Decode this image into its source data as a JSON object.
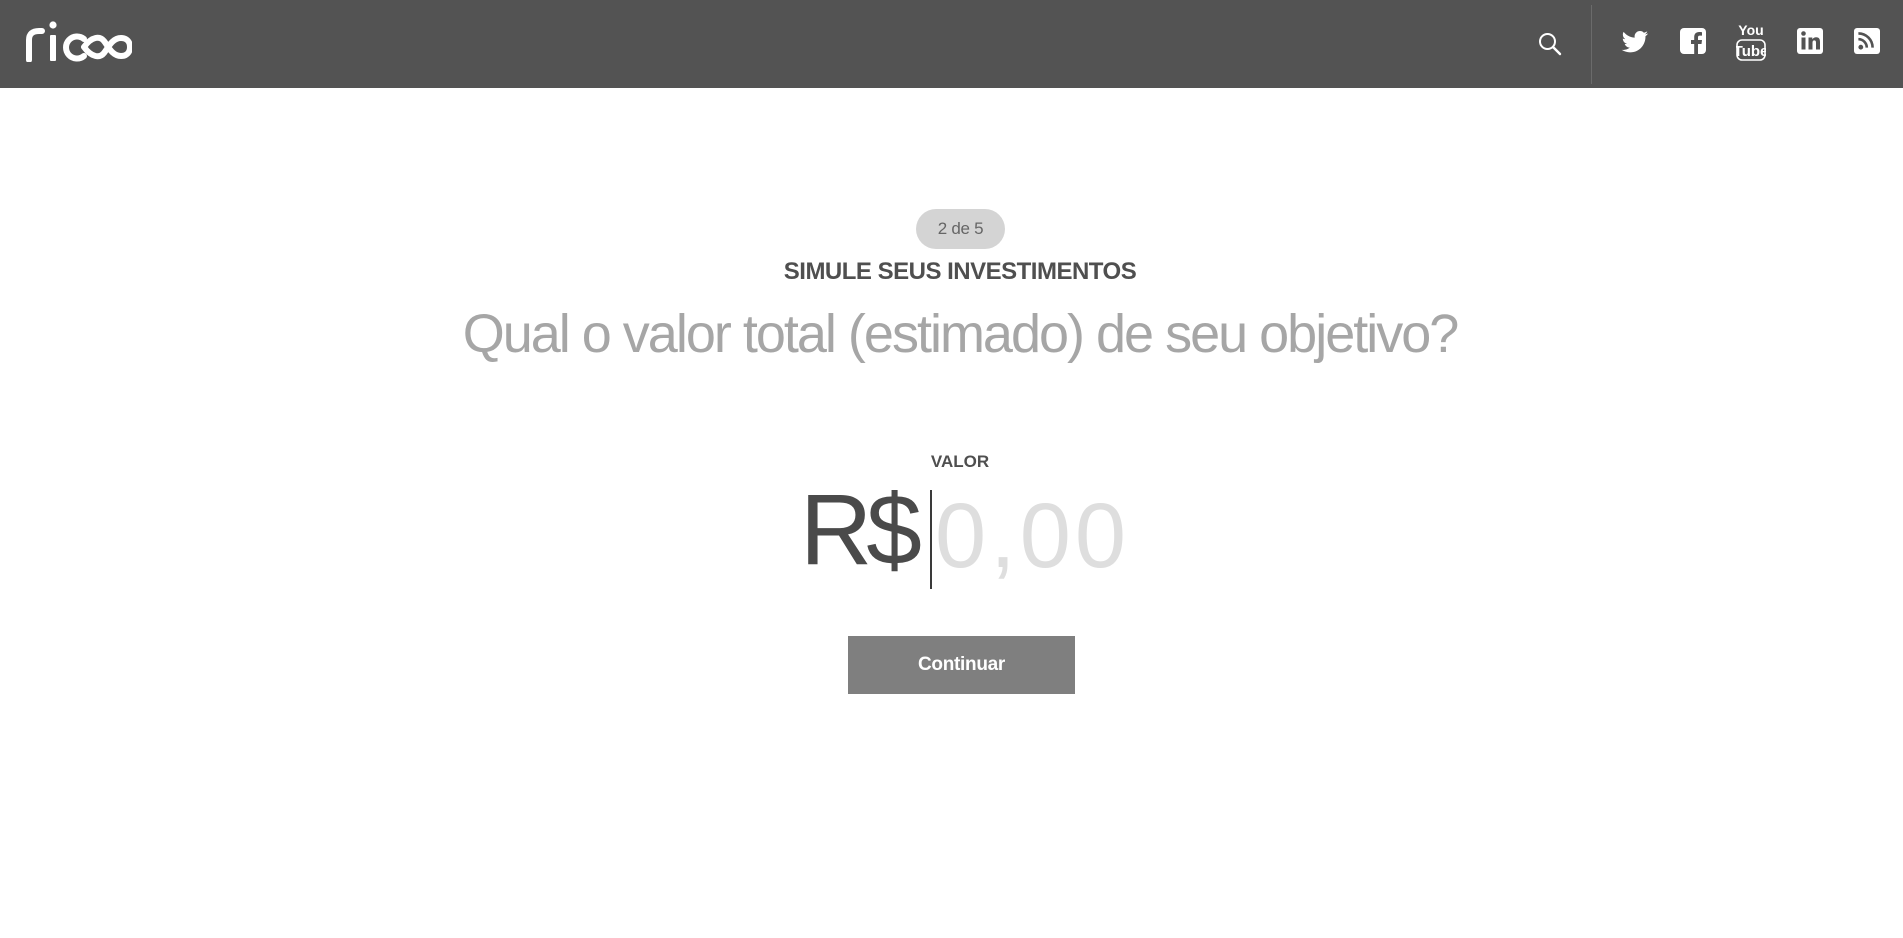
{
  "header": {
    "logo_text": "rico",
    "colors": {
      "bar": "#535353",
      "icon": "#ffffff"
    },
    "icons": [
      "search-icon",
      "twitter-icon",
      "facebook-icon",
      "youtube-icon",
      "linkedin-icon",
      "rss-icon"
    ]
  },
  "step": {
    "badge": "2 de 5"
  },
  "form": {
    "section_title": "SIMULE SEUS INVESTIMENTOS",
    "question": "Qual o valor total (estimado) de seu objetivo?",
    "field_label": "VALOR",
    "currency": "R$",
    "amount_placeholder": "0,00",
    "continue_label": "Continuar"
  },
  "colors": {
    "button": "#7f7f7f",
    "badge": "#d4d4d4",
    "title_text": "#4f4f4f",
    "question_text": "#a6a6a6"
  }
}
